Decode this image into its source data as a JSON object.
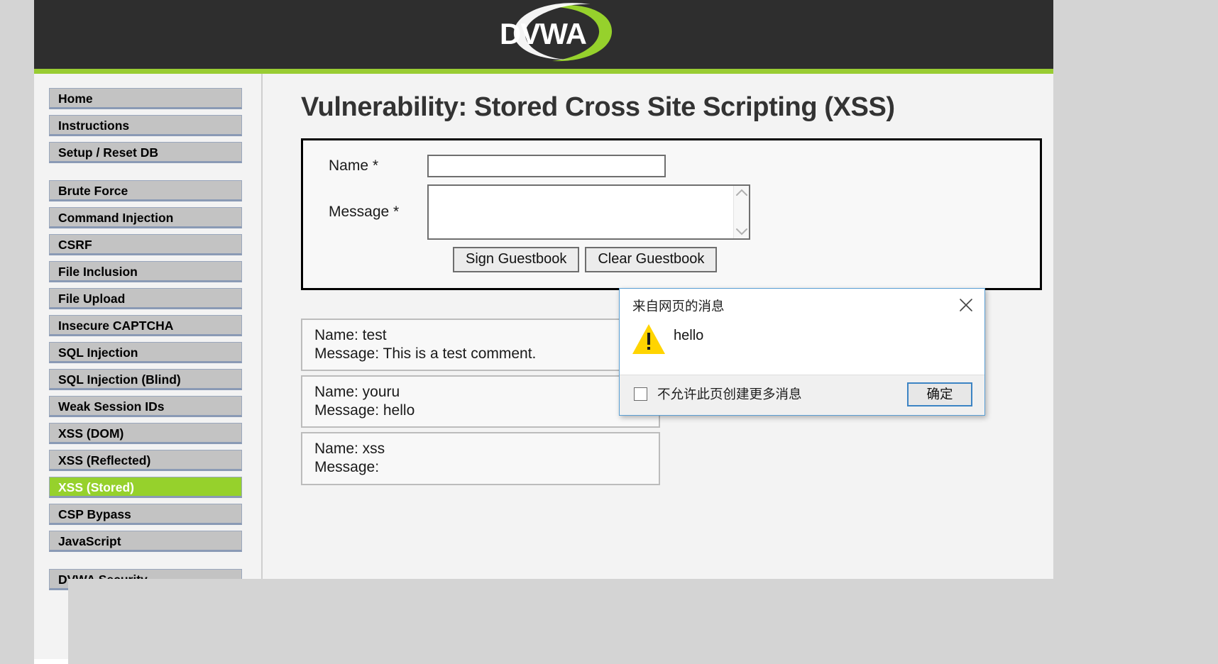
{
  "header": {
    "logo_text": "DVWA",
    "accent_color": "#99cc33",
    "bar_color": "#2e2e2e"
  },
  "sidebar": {
    "groups": [
      {
        "items": [
          {
            "label": "Home",
            "active": false
          },
          {
            "label": "Instructions",
            "active": false
          },
          {
            "label": "Setup / Reset DB",
            "active": false
          }
        ]
      },
      {
        "items": [
          {
            "label": "Brute Force",
            "active": false
          },
          {
            "label": "Command Injection",
            "active": false
          },
          {
            "label": "CSRF",
            "active": false
          },
          {
            "label": "File Inclusion",
            "active": false
          },
          {
            "label": "File Upload",
            "active": false
          },
          {
            "label": "Insecure CAPTCHA",
            "active": false
          },
          {
            "label": "SQL Injection",
            "active": false
          },
          {
            "label": "SQL Injection (Blind)",
            "active": false
          },
          {
            "label": "Weak Session IDs",
            "active": false
          },
          {
            "label": "XSS (DOM)",
            "active": false
          },
          {
            "label": "XSS (Reflected)",
            "active": false
          },
          {
            "label": "XSS (Stored)",
            "active": true
          },
          {
            "label": "CSP Bypass",
            "active": false
          },
          {
            "label": "JavaScript",
            "active": false
          }
        ]
      },
      {
        "items": [
          {
            "label": "DVWA Security",
            "active": false
          }
        ]
      }
    ],
    "active_color": "#96d12c"
  },
  "main": {
    "page_title": "Vulnerability: Stored Cross Site Scripting (XSS)",
    "form": {
      "name_label": "Name *",
      "name_value": "",
      "name_placeholder": "",
      "message_label": "Message *",
      "message_value": "",
      "message_placeholder": "",
      "sign_button": "Sign Guestbook",
      "clear_button": "Clear Guestbook"
    },
    "guestbook": [
      {
        "name_line": "Name: test",
        "message_line": "Message: This is a test comment."
      },
      {
        "name_line": "Name: youru",
        "message_line": "Message: hello"
      },
      {
        "name_line": "Name: xss",
        "message_line": "Message:"
      }
    ]
  },
  "dialog": {
    "title": "来自网页的消息",
    "message": "hello",
    "checkbox_label": "不允许此页创建更多消息",
    "checkbox_checked": false,
    "ok_button": "确定",
    "border_color": "#5a9fd4",
    "warn_color": "#ffd400"
  }
}
